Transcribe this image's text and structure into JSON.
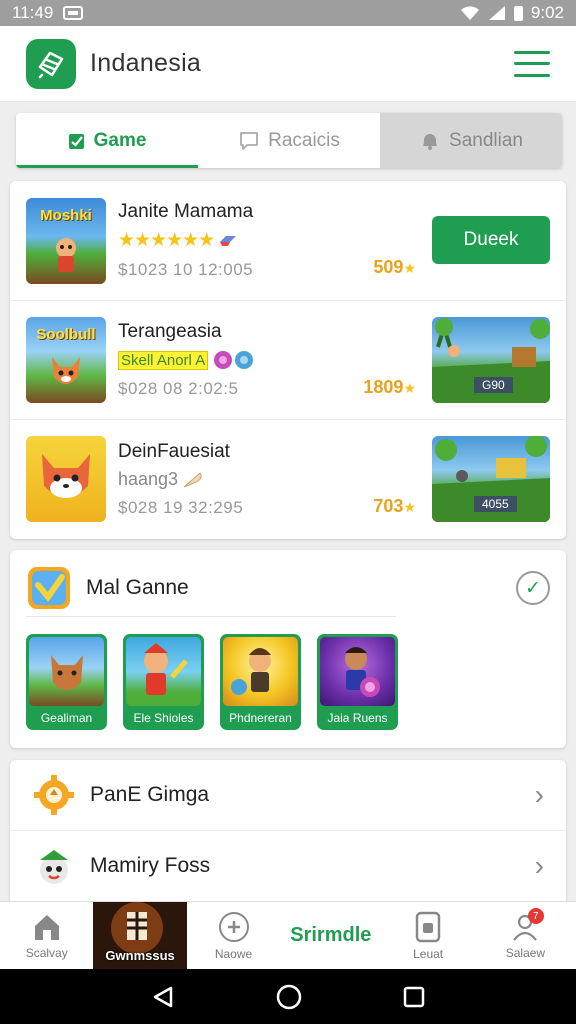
{
  "status_bar": {
    "time_left": "11:49",
    "time_right": "9:02"
  },
  "app_bar": {
    "title": "Indanesia"
  },
  "tabs": [
    {
      "label": "Game"
    },
    {
      "label": "Racaicis"
    },
    {
      "label": "Sandlian"
    }
  ],
  "featured": [
    {
      "title": "Janite Mamama",
      "stars": "★★★★★★",
      "meta": "$1023  10  12:005",
      "coins": "509",
      "thumb_text": "Moshki",
      "action_label": "Dueek"
    },
    {
      "title": "Terangeasia",
      "tag": "Skell Anorl A",
      "meta": "$028  08  2:02:5",
      "coins": "1809",
      "thumb_text": "Soolbull",
      "preview_label": "G90"
    },
    {
      "title": "DeinFauesiat",
      "subtitle": "haang3",
      "meta": "$028  19  32:295",
      "coins": "703",
      "preview_label": "4055"
    }
  ],
  "section": {
    "title": "Mal Ganne",
    "games": [
      {
        "label": "Gealiman"
      },
      {
        "label": "Ele Shioles"
      },
      {
        "label": "Phdnereran"
      },
      {
        "label": "Jaia Ruens"
      }
    ]
  },
  "list": [
    {
      "label": "PanE Gimga"
    },
    {
      "label": "Mamiry Foss"
    }
  ],
  "bottom_nav": {
    "item1": "Scalvay",
    "feature": "Gwnmssus",
    "item3": "Naowe",
    "brand": "Srirmdle",
    "item5": "Leuat",
    "item6": "Salaew",
    "badge": "7"
  },
  "colors": {
    "brand": "#1f9e52",
    "coin": "#e9a21b",
    "star": "#f6c31a"
  }
}
